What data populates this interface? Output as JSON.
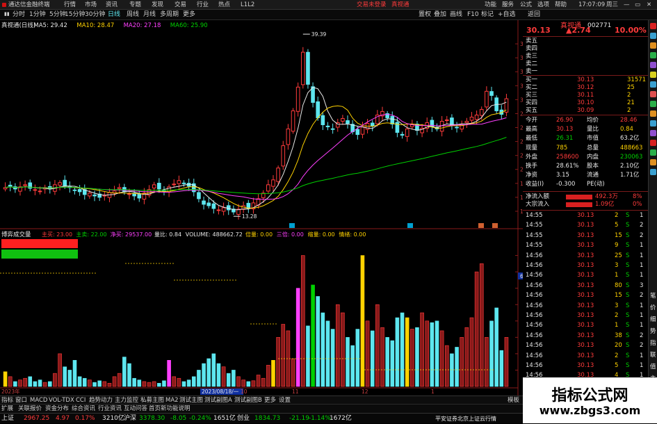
{
  "titlebar": {
    "app_title": "通达信金融终端",
    "menus": [
      "行情",
      "市场",
      "资讯",
      "专题",
      "发现",
      "交易",
      "行业",
      "热点",
      "L1L2"
    ],
    "center_links": [
      "交易未登录",
      "真视通"
    ],
    "right_links": [
      "功能",
      "服务",
      "公式",
      "选项",
      "帮助"
    ],
    "time": "17:07:09",
    "weekday": "周三"
  },
  "menubar": {
    "stock": "真视通(日线)",
    "periods": [
      "分时",
      "1分钟",
      "5分钟",
      "15分钟",
      "30分钟",
      "日线",
      "周线",
      "月线",
      "多周期",
      "更多"
    ],
    "active_period": "日线",
    "right_items": [
      "置权",
      "叠加",
      "画线",
      "F10",
      "标记",
      "+自选",
      "返回"
    ]
  },
  "main_chart": {
    "legend": [
      {
        "text": "真视通(日线)",
        "color": "#e8e8e8"
      },
      {
        "text": "MA5: 29.42",
        "color": "#e8e8e8"
      },
      {
        "text": "MA10: 28.47",
        "color": "#ffd200"
      },
      {
        "text": "MA20: 27.18",
        "color": "#ff40ff"
      },
      {
        "text": "MA60: 25.90",
        "color": "#00d000"
      }
    ],
    "high_label": "39.39",
    "low_label": "13.28",
    "y_ticks": [
      "38.00",
      "36.00",
      "34.00",
      "32.00",
      "30.00",
      "28.00",
      "26.00",
      "24.00",
      "22.00",
      "20.00",
      "18.00",
      "16.00",
      "14.00"
    ],
    "markers": [
      "财",
      "财",
      "财",
      "财"
    ]
  },
  "volume_chart": {
    "indicator_name": "博弈成交量",
    "legend": [
      {
        "text": "主买: 23.00",
        "color": "#ff3b3b"
      },
      {
        "text": "主卖: 22.00",
        "color": "#00d000"
      },
      {
        "text": "净买: 29537.00",
        "color": "#ff40ff"
      },
      {
        "text": "量比: 0.84",
        "color": "#e8e8e8"
      },
      {
        "text": "VOLUME: 488662.72",
        "color": "#e8e8e8"
      },
      {
        "text": "倍量: 0.00",
        "color": "#ffd200"
      },
      {
        "text": "三倍: 0.00",
        "color": "#ff40ff"
      },
      {
        "text": "缩量: 0.00",
        "color": "#ffd200"
      },
      {
        "text": "情绪: 0.00",
        "color": "#ffd200"
      }
    ],
    "y_ticks": [
      "80000",
      "70000",
      "60000",
      "50000",
      "40000",
      "30000",
      "20000",
      "10000"
    ],
    "cursor_label": "65110",
    "x_labels": [
      "2023年",
      "2023/08/18/一",
      "10",
      "11",
      "12",
      "1"
    ]
  },
  "bottom_tabs": [
    "指标",
    "窗口",
    "MACD",
    "VOL-TDX",
    "CCI",
    "趋势动力",
    "主力监控",
    "私募主图",
    "MA2",
    "测试主图",
    "测试副图A",
    "测试副图B",
    "更多",
    "设置",
    "模板"
  ],
  "bottom_tabs2": [
    "扩展",
    "关联报价",
    "资金分布",
    "综合资讯",
    "行业资讯",
    "互动问答",
    "首页新功能说明"
  ],
  "quote": {
    "name": "真视通",
    "code": "002771",
    "price": "30.13",
    "change": "▲2.74",
    "pct": "10.00%",
    "sell_labels": [
      "卖五",
      "卖四",
      "卖三",
      "卖二",
      "卖一"
    ],
    "buy": [
      {
        "label": "买一",
        "price": "30.13",
        "vol": "31571"
      },
      {
        "label": "买二",
        "price": "30.12",
        "vol": "25"
      },
      {
        "label": "买三",
        "price": "30.11",
        "vol": "2"
      },
      {
        "label": "买四",
        "price": "30.10",
        "vol": "21"
      },
      {
        "label": "买五",
        "price": "30.09",
        "vol": "2"
      }
    ],
    "stats": [
      {
        "l1": "今开",
        "v1": "26.90",
        "c1": "#ff3b3b",
        "l2": "均价",
        "v2": "28.46",
        "c2": "#ff3b3b"
      },
      {
        "l1": "最高",
        "v1": "30.13",
        "c1": "#ff3b3b",
        "l2": "量比",
        "v2": "0.84",
        "c2": "#ffd200"
      },
      {
        "l1": "最低",
        "v1": "26.31",
        "c1": "#00d000",
        "l2": "市值",
        "v2": "63.2亿",
        "c2": "#e8e8e8"
      },
      {
        "l1": "现量",
        "v1": "785",
        "c1": "#ffd200",
        "l2": "总量",
        "v2": "488663",
        "c2": "#ffd200"
      },
      {
        "l1": "外盘",
        "v1": "258600",
        "c1": "#ff3b3b",
        "l2": "内盘",
        "v2": "230063",
        "c2": "#00d000"
      },
      {
        "l1": "换手",
        "v1": "28.61%",
        "c1": "#e8e8e8",
        "l2": "股本",
        "v2": "2.10亿",
        "c2": "#e8e8e8"
      },
      {
        "l1": "净资",
        "v1": "3.15",
        "c1": "#e8e8e8",
        "l2": "流通",
        "v2": "1.71亿",
        "c2": "#e8e8e8"
      },
      {
        "l1": "收益(I)",
        "v1": "-0.300",
        "c1": "#e8e8e8",
        "l2": "PE(动)",
        "v2": "",
        "c2": "#e8e8e8"
      }
    ],
    "flow": [
      {
        "label": "净流入额",
        "value": "492.3万",
        "pct": "8%"
      },
      {
        "label": "大宗流入",
        "value": "1.09亿",
        "pct": "0%"
      }
    ],
    "ticks": [
      {
        "t": "14:55",
        "p": "30.13",
        "v": "2",
        "s": "S",
        "n": "1"
      },
      {
        "t": "14:55",
        "p": "30.13",
        "v": "5",
        "s": "S",
        "n": "2"
      },
      {
        "t": "14:55",
        "p": "30.13",
        "v": "15",
        "s": "S",
        "n": "2"
      },
      {
        "t": "14:55",
        "p": "30.13",
        "v": "9",
        "s": "S",
        "n": "1"
      },
      {
        "t": "14:56",
        "p": "30.13",
        "v": "25",
        "s": "S",
        "n": "1"
      },
      {
        "t": "14:56",
        "p": "30.13",
        "v": "3",
        "s": "S",
        "n": "1"
      },
      {
        "t": "14:56",
        "p": "30.13",
        "v": "1",
        "s": "S",
        "n": "1"
      },
      {
        "t": "14:56",
        "p": "30.13",
        "v": "80",
        "s": "S",
        "n": "3"
      },
      {
        "t": "14:56",
        "p": "30.13",
        "v": "15",
        "s": "S",
        "n": "2"
      },
      {
        "t": "14:56",
        "p": "30.13",
        "v": "3",
        "s": "S",
        "n": "1"
      },
      {
        "t": "14:56",
        "p": "30.13",
        "v": "2",
        "s": "S",
        "n": "1"
      },
      {
        "t": "14:56",
        "p": "30.13",
        "v": "1",
        "s": "S",
        "n": "1"
      },
      {
        "t": "14:56",
        "p": "30.13",
        "v": "38",
        "s": "S",
        "n": "2"
      },
      {
        "t": "14:56",
        "p": "30.13",
        "v": "20",
        "s": "S",
        "n": "2"
      },
      {
        "t": "14:56",
        "p": "30.13",
        "v": "2",
        "s": "S",
        "n": "1"
      },
      {
        "t": "14:56",
        "p": "30.13",
        "v": "5",
        "s": "S",
        "n": "1"
      },
      {
        "t": "14:56",
        "p": "30.13",
        "v": "4",
        "s": "S",
        "n": "1"
      }
    ],
    "tabs": [
      "笔",
      "价",
      "细",
      "势",
      "指",
      "联",
      "值",
      "主",
      "筹"
    ]
  },
  "statusbar": {
    "items": [
      {
        "text": "上证",
        "color": "#e8e8e8"
      },
      {
        "text": "2967.25",
        "color": "#ff3b3b"
      },
      {
        "text": "4.97",
        "color": "#ff3b3b"
      },
      {
        "text": "0.17%",
        "color": "#ff3b3b"
      },
      {
        "text": "3210亿",
        "color": "#e8e8e8"
      },
      {
        "text": "沪深",
        "color": "#e8e8e8"
      },
      {
        "text": "3378.30",
        "color": "#00d000"
      },
      {
        "text": "-8.05",
        "color": "#00d000"
      },
      {
        "text": "-0.24%",
        "color": "#00d000"
      },
      {
        "text": "1651亿",
        "color": "#e8e8e8"
      },
      {
        "text": "创业",
        "color": "#e8e8e8"
      },
      {
        "text": "1834.73",
        "color": "#00d000"
      },
      {
        "text": "-21.19",
        "color": "#00d000"
      },
      {
        "text": "-1.14%",
        "color": "#00d000"
      },
      {
        "text": "1672亿",
        "color": "#e8e8e8"
      }
    ],
    "server": "平安证券北京上证云行情"
  },
  "watermark": {
    "title": "指标公式网",
    "url": "www.zbgs3.com"
  },
  "chart_data": [
    {
      "type": "candlestick",
      "title": "真视通(日线)",
      "ylim": [
        13,
        40
      ],
      "ma": {
        "MA5": 29.42,
        "MA10": 28.47,
        "MA20": 27.18,
        "MA60": 25.9
      },
      "high": 39.39,
      "low": 13.28,
      "close": [
        17.4,
        17.6,
        17.2,
        17.5,
        17.8,
        17.3,
        17.1,
        16.9,
        17.4,
        17.2,
        17.8,
        18.1,
        17.6,
        17.4,
        17.0,
        16.8,
        16.4,
        16.6,
        16.2,
        16.0,
        16.3,
        16.7,
        16.9,
        17.4,
        16.8,
        16.5,
        16.2,
        15.9,
        16.6,
        17.1,
        17.8,
        17.2,
        16.9,
        17.5,
        17.9,
        18.4,
        18.0,
        17.6,
        16.8,
        15.8,
        15.0,
        14.8,
        14.4,
        14.2,
        14.5,
        14.2,
        13.9,
        14.3,
        14.8,
        14.4,
        15.2,
        15.8,
        16.6,
        17.8,
        18.5,
        20.2,
        23.4,
        25.8,
        28.4,
        31.8,
        36.8,
        32.2,
        29.6,
        27.4,
        26.4,
        26.1,
        25.8,
        26.7,
        27.3,
        26.6,
        25.4,
        25.0,
        26.1,
        26.6,
        26.2,
        27.8,
        28.3,
        27.4,
        26.5,
        25.3,
        24.9,
        25.8,
        26.4,
        25.6,
        25.9,
        26.7,
        26.1,
        25.8,
        26.9,
        27.1,
        26.3,
        26.0,
        26.4,
        26.9,
        27.5,
        27.8,
        28.6,
        31.2,
        30.6,
        28.4,
        27.9,
        30.13
      ]
    },
    {
      "type": "bar",
      "title": "博弈成交量",
      "ylim": [
        0,
        90000
      ],
      "values": [
        9000,
        6000,
        3000,
        4000,
        5000,
        6000,
        3000,
        4000,
        2500,
        3000,
        8000,
        20000,
        12000,
        10000,
        16000,
        6000,
        5000,
        4000,
        2500,
        3500,
        3000,
        2000,
        6000,
        8000,
        18000,
        14000,
        5000,
        4000,
        3000,
        2500,
        3000,
        2000,
        3500,
        16000,
        6000,
        5000,
        3000,
        4000,
        6000,
        10000,
        14000,
        17000,
        20000,
        14000,
        12000,
        8000,
        10000,
        6000,
        4000,
        3000,
        3500,
        7000,
        5000,
        13000,
        16000,
        30000,
        38000,
        34000,
        17000,
        60000,
        80000,
        37000,
        62000,
        55000,
        45000,
        40000,
        35000,
        50000,
        45000,
        30000,
        25000,
        35000,
        80000,
        40000,
        34000,
        50000,
        36000,
        30000,
        28000,
        42000,
        45000,
        42000,
        35000,
        36000,
        45000,
        40000,
        39000,
        40000,
        34000,
        25000,
        20000,
        24000,
        30000,
        36000,
        42000,
        70000,
        75000,
        30000,
        40000,
        48000,
        22000,
        30000
      ]
    }
  ]
}
